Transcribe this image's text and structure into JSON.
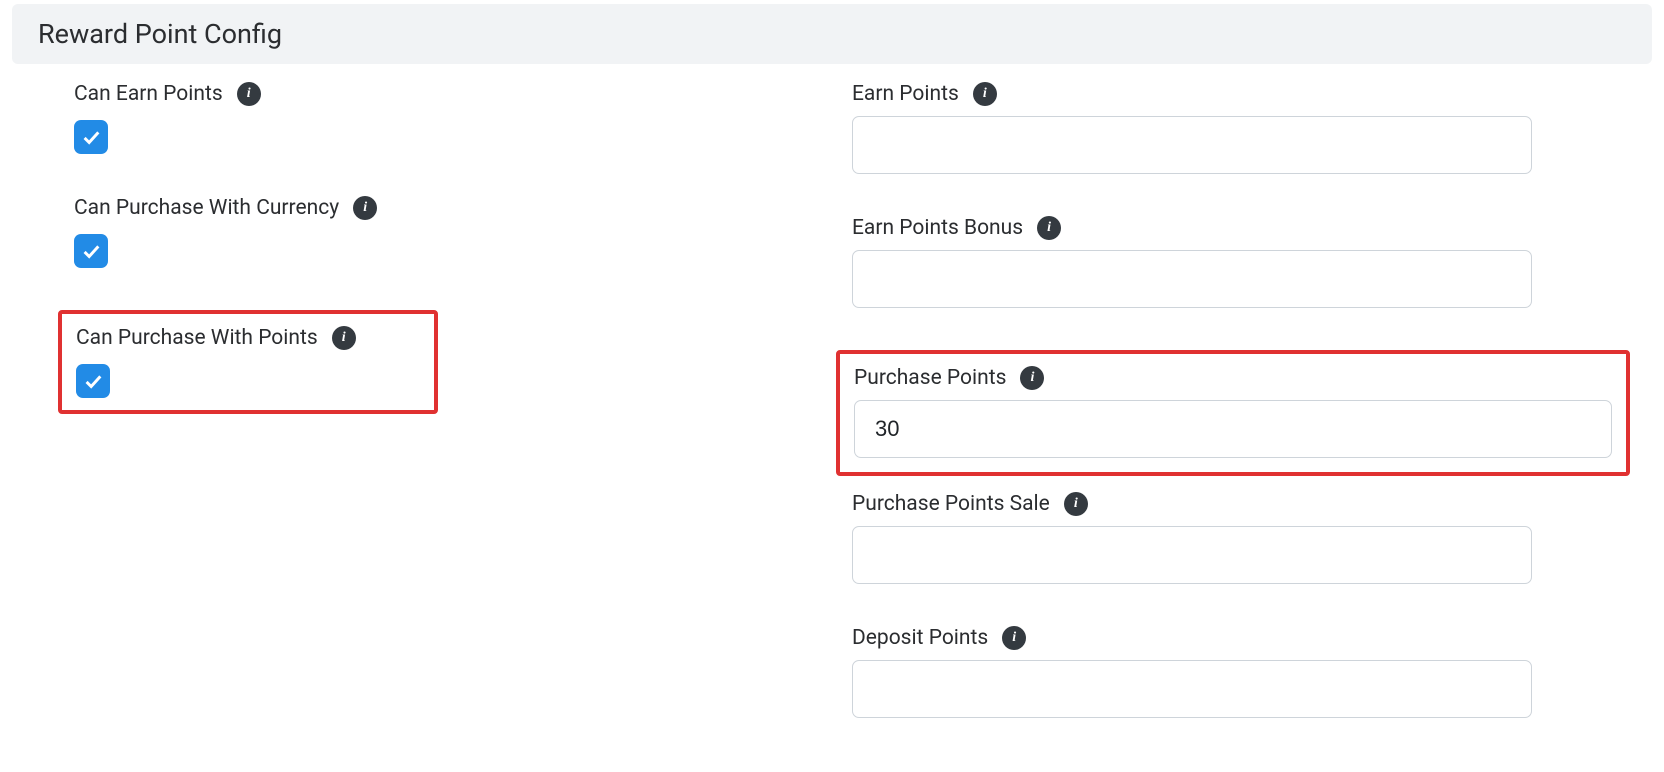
{
  "header": {
    "title": "Reward Point Config"
  },
  "left": {
    "can_earn_label": "Can Earn Points",
    "can_purchase_currency_label": "Can Purchase With Currency",
    "can_purchase_points_label": "Can Purchase With Points"
  },
  "right": {
    "earn_points_label": "Earn Points",
    "earn_points_value": "",
    "earn_points_bonus_label": "Earn Points Bonus",
    "earn_points_bonus_value": "",
    "purchase_points_label": "Purchase Points",
    "purchase_points_value": "30",
    "purchase_points_sale_label": "Purchase Points Sale",
    "purchase_points_sale_value": "",
    "deposit_points_label": "Deposit Points",
    "deposit_points_value": ""
  },
  "info_glyph": "i"
}
